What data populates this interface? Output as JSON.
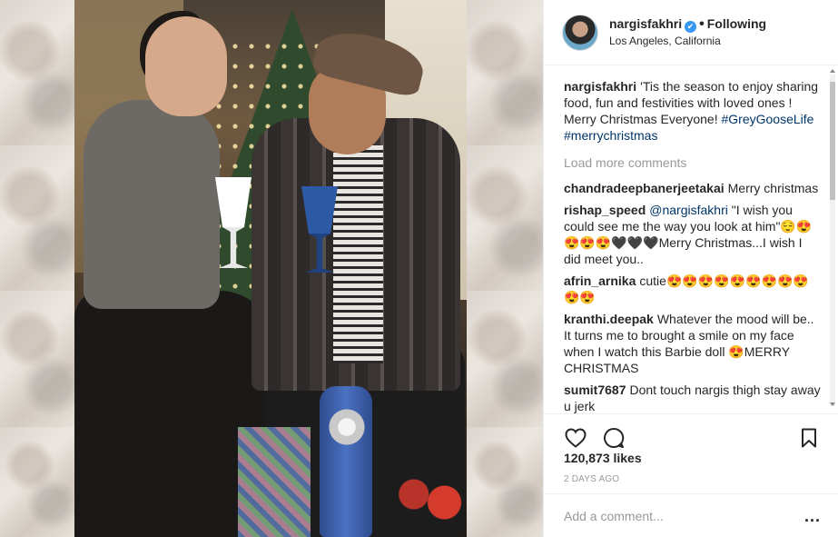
{
  "post": {
    "username": "nargisfakhri",
    "follow_status": "Following",
    "location": "Los Angeles, California",
    "caption_user": "nargisfakhri",
    "caption_text": "'Tis the season to enjoy sharing food, fun and festivities with loved ones ! Merry Christmas Everyone! ",
    "hashtag1": "#GreyGooseLife",
    "hashtag2": "#merrychristmas",
    "load_more": "Load more comments",
    "likes": "120,873 likes",
    "age": "2 DAYS AGO",
    "comment_placeholder": "Add a comment...",
    "more_label": "..."
  },
  "comments": [
    {
      "user": "chandradeepbanerjeetakai",
      "text": "Merry christmas"
    },
    {
      "user": "rishap_speed",
      "mention": "@nargisfakhri",
      "text": " \"I wish you could see me the way you look at him\"😌😍😍😍😍🖤🖤🖤Merry Christmas...I wish I did meet you.."
    },
    {
      "user": "afrin_arnika",
      "text": "cutie😍😍😍😍😍😍😍😍😍😍😍"
    },
    {
      "user": "kranthi.deepak",
      "text": "Whatever the mood will be.. It turns me to brought a smile on my face when I watch this Barbie doll 😍MERRY CHRISTMAS"
    },
    {
      "user": "sumit7687",
      "text": "Dont touch nargis thigh stay away u jerk"
    }
  ],
  "colors": {
    "accent_blue": "#3897f0",
    "hashtag": "#003569",
    "muted": "#999999",
    "border": "#efefef"
  },
  "icons": [
    "heart-icon",
    "comment-icon",
    "bookmark-icon",
    "verified-icon",
    "more-options-icon"
  ]
}
